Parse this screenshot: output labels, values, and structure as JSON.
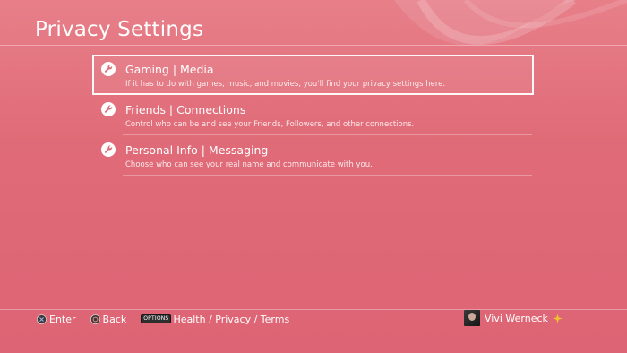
{
  "header": {
    "title": "Privacy Settings"
  },
  "menu": {
    "items": [
      {
        "title": "Gaming | Media",
        "description": "If it has to do with games, music, and movies, you'll find your privacy settings here.",
        "icon": "wrench-icon",
        "selected": true
      },
      {
        "title": "Friends | Connections",
        "description": "Control who can be and see your Friends, Followers, and other connections.",
        "icon": "wrench-icon",
        "selected": false
      },
      {
        "title": "Personal Info | Messaging",
        "description": "Choose who can see your real name and communicate with you.",
        "icon": "wrench-icon",
        "selected": false
      }
    ]
  },
  "footer": {
    "enter_label": "Enter",
    "back_label": "Back",
    "options_badge": "OPTIONS",
    "options_label": "Health / Privacy / Terms"
  },
  "user": {
    "name": "Vivi Werneck",
    "plus_icon": "plus-star-icon"
  },
  "colors": {
    "background": "#e06b78",
    "text": "#ffffff",
    "plus_gold": "#f2c230"
  }
}
